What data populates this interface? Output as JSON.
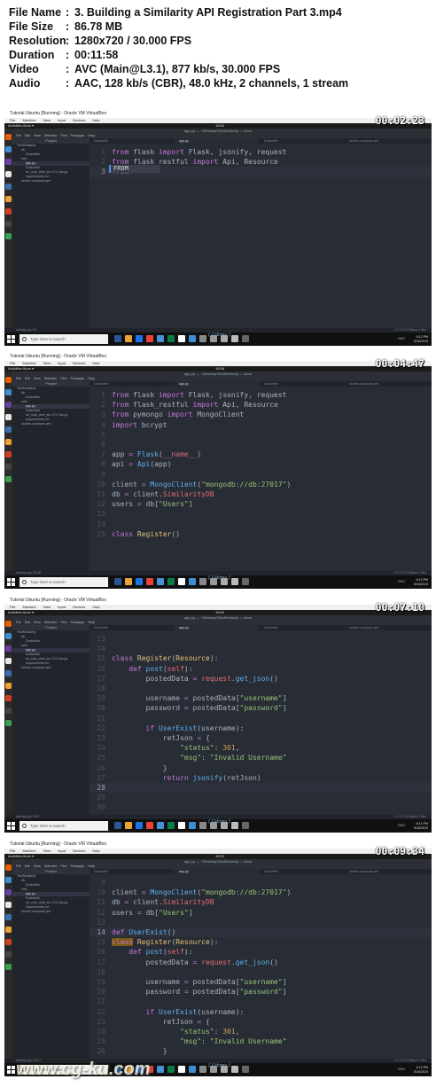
{
  "info": [
    {
      "key": "File Name",
      "value": "3. Building a Similarity API Registration Part 3.mp4"
    },
    {
      "key": "File Size",
      "value": "86.78 MB"
    },
    {
      "key": "Resolution",
      "value": "1280x720 / 30.000 FPS"
    },
    {
      "key": "Duration",
      "value": "00:11:58"
    },
    {
      "key": "Video",
      "value": "AVC (Main@L3.1), 877 kb/s, 30.000 FPS"
    },
    {
      "key": "Audio",
      "value": "AAC, 128 kb/s (CBR), 48.0 kHz, 2 channels, 1 stream"
    }
  ],
  "separator": ":",
  "chrome": {
    "vbox_title": "Tutorial Ubuntu [Running] - Oracle VM VirtualBox",
    "vbox_menu": [
      "File",
      "Machine",
      "View",
      "Input",
      "Devices",
      "Help"
    ],
    "gnome_activities": "Activities",
    "gnome_app": "Atom ▾",
    "atom_menu": [
      "File",
      "Edit",
      "View",
      "Selection",
      "Find",
      "Packages",
      "Help"
    ],
    "project_label": "Project",
    "search_placeholder": "Type here to search",
    "watermark": "{ Udemy }",
    "tray_lang": "ENG",
    "tray_time": "6:12 PM",
    "tray_date": "5/16/2019"
  },
  "frames": [
    {
      "timestamp": "00:02:23",
      "clock": "18:54",
      "window_title": "app.py — ~/Desktop/TestSimilarity — Atom",
      "tabs": [
        "Dockerfile",
        "app.py",
        "Dockerfile",
        "docker-compose.yml"
      ],
      "active_tab": 1,
      "tree": [
        "TestSimilarity",
        "db",
        "Dockerfile",
        "web",
        "app.py",
        "Dockerfile",
        "en_core_web_sm-2.0.0.tar.gz",
        "requirements.txt",
        "docker-compose.yml"
      ],
      "tree_selected": 4,
      "status_left": "web/app.py  3:8",
      "status_right": "LF  UTF-8  Python  0 files",
      "autocomplete": "FROM",
      "current_line": 2,
      "lines": [
        {
          "n": "1",
          "html": "<span class='k'>from</span> flask <span class='k'>import</span> Flask, jsonify, request"
        },
        {
          "n": "2",
          "html": "<span class='k'>from</span> flask_restful <span class='k'>import</span> Api, Resource"
        },
        {
          "n": "3",
          "html": "<span class='k'>from</span>"
        }
      ]
    },
    {
      "timestamp": "00:04:47",
      "clock": "18:56",
      "window_title": "app.py — ~/Desktop/TestSimilarity — Atom",
      "tabs": [
        "Dockerfile",
        "app.py",
        "Dockerfile",
        "docker-compose.yml"
      ],
      "active_tab": 1,
      "tree": [
        "TestSimilarity",
        "db",
        "Dockerfile",
        "web",
        "app.py",
        "Dockerfile",
        "en_core_web_sm-2.0.0.tar.gz",
        "requirements.txt",
        "docker-compose.yml"
      ],
      "tree_selected": 4,
      "status_left": "web/app.py*  15:16",
      "status_right": "LF  UTF-8  Python  0 files",
      "autocomplete": "",
      "current_line": -1,
      "lines": [
        {
          "n": "1",
          "html": "<span class='k'>from</span> flask <span class='k'>import</span> Flask, jsonify, request"
        },
        {
          "n": "2",
          "html": "<span class='k'>from</span> flask_restful <span class='k'>import</span> Api, Resource"
        },
        {
          "n": "3",
          "html": "<span class='k'>from</span> pymongo <span class='k'>import</span> MongoClient"
        },
        {
          "n": "4",
          "html": "<span class='k'>import</span> bcrypt"
        },
        {
          "n": "5",
          "html": ""
        },
        {
          "n": "6",
          "html": ""
        },
        {
          "n": "7",
          "html": "app <span class='k'>=</span> <span class='f'>Flask</span>(<span class='r'>__name__</span>)"
        },
        {
          "n": "8",
          "html": "api <span class='k'>=</span> <span class='f'>Api</span>(app)"
        },
        {
          "n": "9",
          "html": ""
        },
        {
          "n": "10",
          "html": "client <span class='k'>=</span> <span class='f'>MongoClient</span>(<span class='s'>\"mongodb://db:27017\"</span>)"
        },
        {
          "n": "11",
          "html": "db <span class='k'>=</span> client.<span class='r'>SimilarityDB</span>"
        },
        {
          "n": "12",
          "html": "users <span class='k'>=</span> db[<span class='s'>\"Users\"</span>]"
        },
        {
          "n": "13",
          "html": ""
        },
        {
          "n": "14",
          "html": ""
        },
        {
          "n": "15",
          "html": "<span class='k'>class</span> <span class='c'>Register</span>()"
        }
      ]
    },
    {
      "timestamp": "00:07:10",
      "clock": "18:59",
      "window_title": "app.py — ~/Desktop/TestSimilarity — Atom",
      "tabs": [
        "Dockerfile",
        "app.py",
        "Dockerfile",
        "docker-compose.yml"
      ],
      "active_tab": 1,
      "tree": [
        "TestSimilarity",
        "db",
        "Dockerfile",
        "web",
        "app.py",
        "Dockerfile",
        "en_core_web_sm-2.0.0.tar.gz",
        "requirements.txt",
        "docker-compose.yml"
      ],
      "tree_selected": 4,
      "status_left": "web/app.py*  29:9",
      "status_right": "LF  UTF-8  Python  0 files",
      "autocomplete": "",
      "current_line": 15,
      "lines": [
        {
          "n": "13",
          "html": ""
        },
        {
          "n": "14",
          "html": ""
        },
        {
          "n": "15",
          "html": "<span class='k'>class</span> <span class='c'>Register</span>(<span class='c'>Resource</span>):"
        },
        {
          "n": "16",
          "html": "    <span class='k'>def</span> <span class='f'>post</span>(<span class='r'>self</span>):"
        },
        {
          "n": "17",
          "html": "        postedData <span class='k'>=</span> <span class='r'>request</span>.<span class='f'>get_json</span>()"
        },
        {
          "n": "18",
          "html": ""
        },
        {
          "n": "19",
          "html": "        username <span class='k'>=</span> postedData[<span class='s'>\"username\"</span>]"
        },
        {
          "n": "20",
          "html": "        password <span class='k'>=</span> postedData[<span class='s'>\"password\"</span>]"
        },
        {
          "n": "21",
          "html": ""
        },
        {
          "n": "22",
          "html": "        <span class='k'>if</span> <span class='f'>UserExist</span>(username):"
        },
        {
          "n": "23",
          "html": "            retJson <span class='k'>=</span> {"
        },
        {
          "n": "24",
          "html": "                <span class='s'>\"status\"</span>: <span class='n'>301</span>,"
        },
        {
          "n": "25",
          "html": "                <span class='s'>\"msg\"</span>: <span class='s'>\"Invalid Username\"</span>"
        },
        {
          "n": "26",
          "html": "            }"
        },
        {
          "n": "27",
          "html": "            <span class='k'>return</span> <span class='f'>jsonify</span>(retJson)"
        },
        {
          "n": "28",
          "html": ""
        },
        {
          "n": "29",
          "html": ""
        },
        {
          "n": "30",
          "html": ""
        }
      ]
    },
    {
      "timestamp": "00:09:34",
      "clock": "19:02",
      "window_title": "app.py — ~/Desktop/TestSimilarity — Atom",
      "tabs": [
        "Dockerfile",
        "app.py",
        "Dockerfile",
        "docker-compose.yml"
      ],
      "active_tab": 1,
      "tree": [
        "TestSimilarity",
        "db",
        "Dockerfile",
        "web",
        "app.py",
        "Dockerfile",
        "en_core_web_sm-2.0.0.tar.gz",
        "requirements.txt",
        "docker-compose.yml"
      ],
      "tree_selected": 4,
      "status_left": "web/app.py*  14:17",
      "status_right": "LF  UTF-8  Python  0 files",
      "autocomplete": "",
      "current_line": 5,
      "lines": [
        {
          "n": "9",
          "html": ""
        },
        {
          "n": "10",
          "html": "client <span class='k'>=</span> <span class='f'>MongoClient</span>(<span class='s'>\"mongodb://db:27017\"</span>)"
        },
        {
          "n": "11",
          "html": "db <span class='k'>=</span> client.<span class='r'>SimilarityDB</span>"
        },
        {
          "n": "12",
          "html": "users <span class='k'>=</span> db[<span class='s'>\"Users\"</span>]"
        },
        {
          "n": "13",
          "html": ""
        },
        {
          "n": "14",
          "html": "<span class='k'>def</span> <span class='f'>UserExist</span>()"
        },
        {
          "n": "15",
          "html": "<span class='k' style='background:#7a5a10'>class</span> <span class='c'>Register</span>(<span class='c'>Resource</span>):"
        },
        {
          "n": "16",
          "html": "    <span class='k'>def</span> <span class='f'>post</span>(<span class='r'>self</span>):"
        },
        {
          "n": "17",
          "html": "        postedData <span class='k'>=</span> <span class='r'>request</span>.<span class='f'>get_json</span>()"
        },
        {
          "n": "18",
          "html": ""
        },
        {
          "n": "19",
          "html": "        username <span class='k'>=</span> postedData[<span class='s'>\"username\"</span>]"
        },
        {
          "n": "20",
          "html": "        password <span class='k'>=</span> postedData[<span class='s'>\"password\"</span>]"
        },
        {
          "n": "21",
          "html": ""
        },
        {
          "n": "22",
          "html": "        <span class='k'>if</span> <span class='f'>UserExist</span>(username):"
        },
        {
          "n": "23",
          "html": "            retJson <span class='k'>=</span> {"
        },
        {
          "n": "24",
          "html": "                <span class='s'>\"status\"</span>: <span class='n'>301</span>,"
        },
        {
          "n": "25",
          "html": "                <span class='s'>\"msg\"</span>: <span class='s'>\"Invalid Username\"</span>"
        },
        {
          "n": "26",
          "html": "            }"
        }
      ]
    }
  ],
  "bottom_watermark": "www.cg-ku.com",
  "colors": {
    "editor_bg": "#282c34",
    "keyword": "#c678dd",
    "function": "#61afef",
    "string": "#98c379",
    "number": "#d19a66"
  }
}
